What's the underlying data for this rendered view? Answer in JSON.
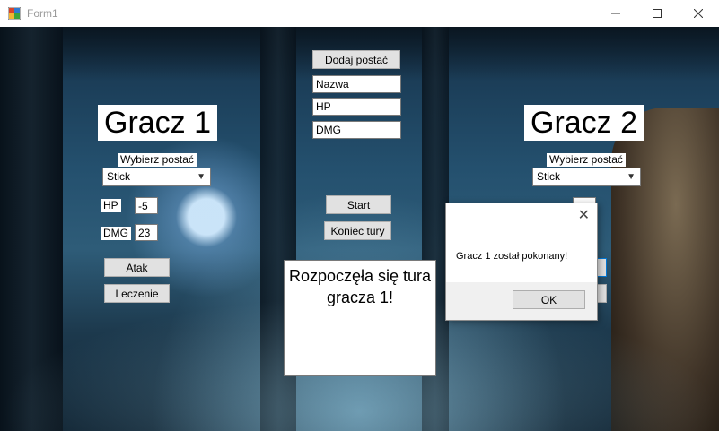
{
  "window": {
    "title": "Form1"
  },
  "center": {
    "add_character_button": "Dodaj postać",
    "name_field": "Nazwa",
    "hp_field": "HP",
    "dmg_field": "DMG",
    "start_button": "Start",
    "end_turn_button": "Koniec tury",
    "status_text": "Rozpoczęła się tura gracza 1!"
  },
  "player1": {
    "title": "Gracz 1",
    "choose_label": "Wybierz postać",
    "character_selected": "Stick",
    "hp_label": "HP",
    "hp_value": "-5",
    "dmg_label": "DMG",
    "dmg_value": "23",
    "attack_button": "Atak",
    "heal_button": "Leczenie"
  },
  "player2": {
    "title": "Gracz 2",
    "choose_label": "Wybierz postać",
    "character_selected": "Stick"
  },
  "dialog": {
    "message": "Gracz 1 został pokonany!",
    "ok_button": "OK",
    "close_glyph": "✕"
  },
  "colors": {
    "control_face": "#e1e1e1",
    "control_border": "#adadad",
    "background_scene": "#24506e"
  }
}
